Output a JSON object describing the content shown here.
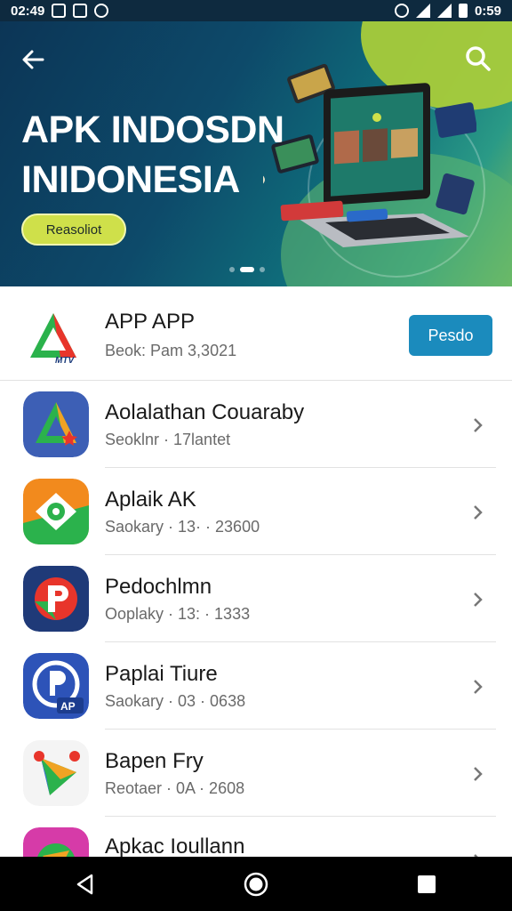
{
  "status": {
    "time_left": "02:49",
    "time_right": "0:59"
  },
  "hero": {
    "title_line1": "APK INDOSDN",
    "title_line2": "INIDONESIA",
    "button_label": "Reasoliot",
    "icons": [
      "back-arrow-icon",
      "search-icon"
    ]
  },
  "featured": {
    "title": "APP APP",
    "subtitle": "Beok: Pam 3,3021",
    "button_label": "Pesdo"
  },
  "list": [
    {
      "title": "Aolalathan Couaraby",
      "subtitle": "Seoklnr · 17lantet"
    },
    {
      "title": "Aplaik AK",
      "subtitle": "Saokary · 13· · 23600"
    },
    {
      "title": "Pedochlmn",
      "subtitle": "Ooplaky · 13: · 1333"
    },
    {
      "title": "Paplai Tiure",
      "subtitle": "Saokary · 03 · 0638"
    },
    {
      "title": "Bapen Fry",
      "subtitle": "Reotaer · 0A · 2608"
    },
    {
      "title": "Apkac Ioullann",
      "subtitle": ""
    }
  ],
  "colors": {
    "accent": "#1b8bbd",
    "hero_button": "#cfe04a",
    "hero_bg": "#0d4a6a"
  }
}
